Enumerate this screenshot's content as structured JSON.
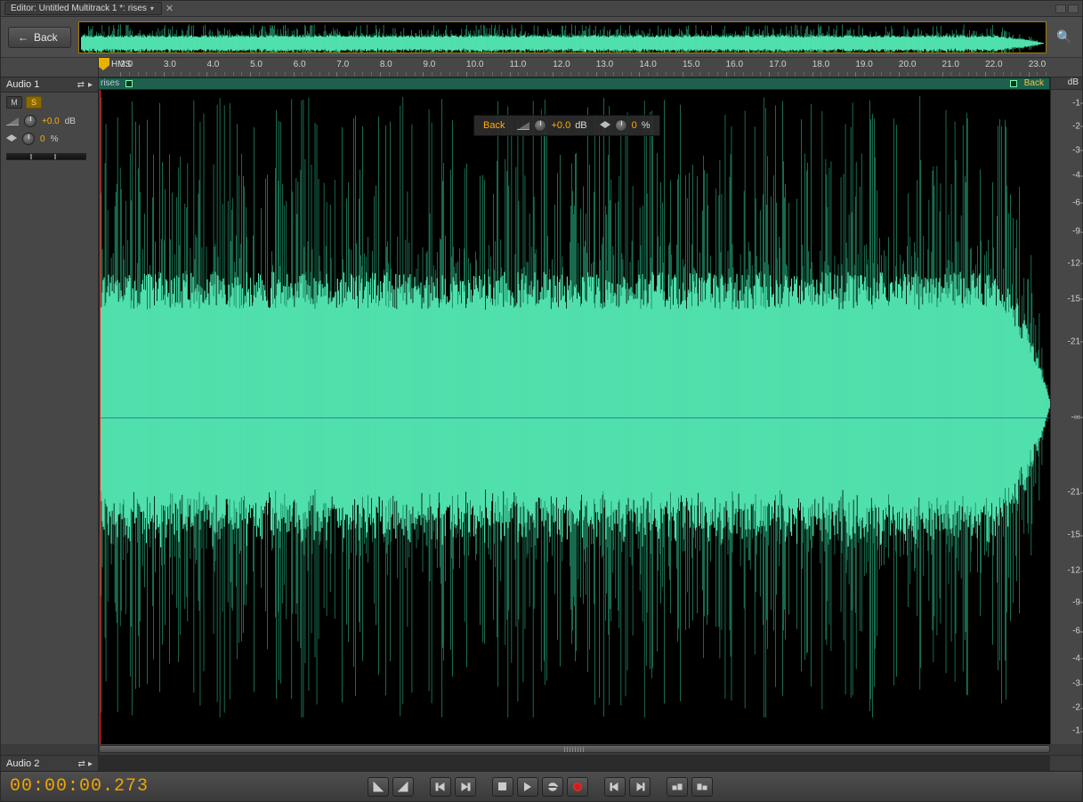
{
  "tab": {
    "label": "Editor: Untitled Multitrack 1 *: rises"
  },
  "back_button": "Back",
  "ruler": {
    "hms_label": "HMS",
    "ticks": [
      "2.0",
      "3.0",
      "4.0",
      "5.0",
      "6.0",
      "7.0",
      "8.0",
      "9.0",
      "10.0",
      "11.0",
      "12.0",
      "13.0",
      "14.0",
      "15.0",
      "16.0",
      "17.0",
      "18.0",
      "19.0",
      "20.0",
      "21.0",
      "22.0",
      "23.0"
    ]
  },
  "tracks": {
    "audio1": {
      "name": "Audio 1",
      "mute_label": "M",
      "solo_label": "S",
      "gain_value": "+0.0",
      "gain_unit": "dB",
      "pan_value": "0",
      "pan_unit": "%"
    },
    "audio2": {
      "name": "Audio 2"
    }
  },
  "clip": {
    "left_label": "rises",
    "right_label": "Back"
  },
  "hud": {
    "back": "Back",
    "gain_value": "+0.0",
    "gain_unit": "dB",
    "pan_value": "0",
    "pan_unit": "%"
  },
  "db_scale": {
    "header": "dB",
    "ticks": [
      "-1",
      "-2",
      "-3",
      "-4",
      "-6",
      "-9",
      "-12",
      "-15",
      "-21",
      "-∞",
      "-21",
      "-15",
      "-12",
      "-9",
      "-6",
      "-4",
      "-3",
      "-2",
      "-1"
    ]
  },
  "timecode": "00:00:00.273"
}
